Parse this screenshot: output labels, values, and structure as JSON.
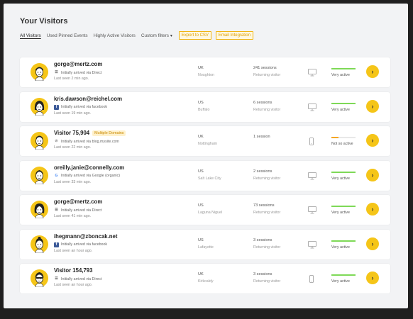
{
  "page": {
    "title": "Your Visitors"
  },
  "filters": {
    "tabs": [
      "All Visitors",
      "Used Pinned Events",
      "Highly Active Visitors"
    ],
    "custom_filters": "Custom filters",
    "export_label": "Export to CSV",
    "email_label": "Email Integration"
  },
  "colors": {
    "accent": "#f5c518",
    "active": "#7ed957",
    "not_so_active": "#f5a623"
  },
  "visitors": [
    {
      "name": "gorge@mertz.com",
      "badge": "",
      "arrival": "Initially arrived via Direct",
      "source_icon": "direct-icon",
      "last_seen": "Last seen 2 min ago.",
      "country": "UK",
      "city": "Noughton",
      "flag": "uk-flag",
      "sessions": "241 sessions",
      "visitor_type": "Returning visitor",
      "device": "desktop-icon",
      "activity_label": "Very active",
      "activity_level": 1.0,
      "activity_color": "#7ed957",
      "avatar": "male"
    },
    {
      "name": "kris.dawson@reichel.com",
      "badge": "",
      "arrival": "Initially arrived via facebook",
      "source_icon": "facebook-icon",
      "last_seen": "Last seen 19 min ago.",
      "country": "US",
      "city": "Buffalo",
      "flag": "us-flag",
      "sessions": "6 sessions",
      "visitor_type": "Returning visitor",
      "device": "desktop-icon",
      "activity_label": "Very active",
      "activity_level": 1.0,
      "activity_color": "#7ed957",
      "avatar": "female"
    },
    {
      "name": "Visitor 75,904",
      "badge": "Multiple Domains",
      "arrival": "Initially arrived via blog.mysite.com",
      "source_icon": "link-icon",
      "last_seen": "Last seen 22 min ago.",
      "country": "UK",
      "city": "Nottingham",
      "flag": "uk-flag",
      "sessions": "1 session",
      "visitor_type": "",
      "device": "mobile-icon",
      "activity_label": "Not so active",
      "activity_level": 0.3,
      "activity_color": "#f5a623",
      "avatar": "visitor"
    },
    {
      "name": "oreilly.janie@connelly.com",
      "badge": "",
      "arrival": "Initially arrived via Google (organic)",
      "source_icon": "google-icon",
      "last_seen": "Last seen 33 min ago.",
      "country": "US",
      "city": "Salt Lake City",
      "flag": "us-flag",
      "sessions": "2 sessions",
      "visitor_type": "Returning visitor",
      "device": "desktop-icon",
      "activity_label": "Very active",
      "activity_level": 1.0,
      "activity_color": "#7ed957",
      "avatar": "male2"
    },
    {
      "name": "gorge@mertz.com",
      "badge": "",
      "arrival": "Initially arrived via Direct",
      "source_icon": "direct-icon",
      "last_seen": "Last seen 41 min ago.",
      "country": "US",
      "city": "Laguna Niguel",
      "flag": "us-flag",
      "sessions": "73 sessions",
      "visitor_type": "Returning visitor",
      "device": "desktop-icon",
      "activity_label": "Very active",
      "activity_level": 1.0,
      "activity_color": "#7ed957",
      "avatar": "female2"
    },
    {
      "name": "ihegmann@zboncak.net",
      "badge": "",
      "arrival": "Initially arrived via facebook",
      "source_icon": "facebook-icon",
      "last_seen": "Last seen an hour ago.",
      "country": "US",
      "city": "Lafayette",
      "flag": "us-flag",
      "sessions": "3 sessions",
      "visitor_type": "Returning visitor",
      "device": "desktop-icon",
      "activity_label": "Very active",
      "activity_level": 1.0,
      "activity_color": "#7ed957",
      "avatar": "female3"
    },
    {
      "name": "Visitor 154,793",
      "badge": "",
      "arrival": "Initially arrived via Direct",
      "source_icon": "direct-icon",
      "last_seen": "Last seen an hour ago.",
      "country": "UK",
      "city": "Kirkcaldy",
      "flag": "uk-flag",
      "sessions": "3 sessions",
      "visitor_type": "Returning visitor",
      "device": "mobile-icon",
      "activity_label": "Very active",
      "activity_level": 1.0,
      "activity_color": "#7ed957",
      "avatar": "male3"
    }
  ]
}
